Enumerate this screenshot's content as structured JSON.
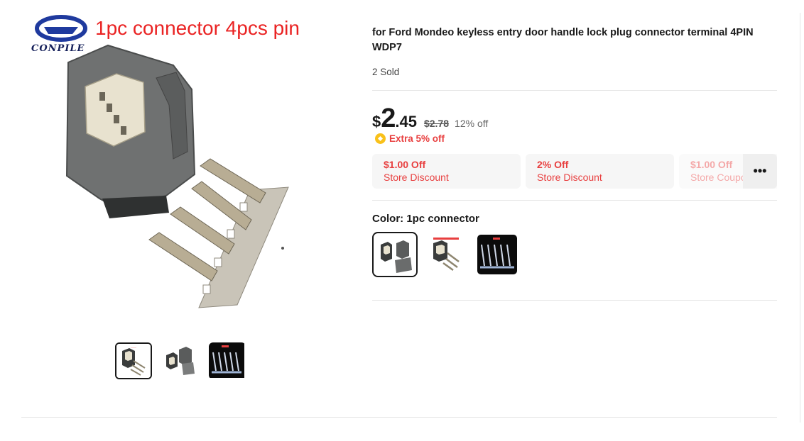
{
  "product": {
    "title": "for Ford Mondeo keyless entry door handle lock plug connector terminal 4PIN WDP7",
    "sold": "2 Sold",
    "image_caption": "1pc connector 4pcs pin",
    "brand": "CONPILE"
  },
  "price": {
    "currency": "$",
    "integer": "2",
    "decimal": ".45",
    "original": "$2.78",
    "discount": "12% off",
    "extra": "Extra 5% off"
  },
  "coupons": [
    {
      "title": "$1.00 Off",
      "subtitle": "Store Discount"
    },
    {
      "title": "2% Off",
      "subtitle": "Store Discount"
    },
    {
      "title": "$1.00 Off",
      "subtitle": "Store Coupon"
    }
  ],
  "more_label": "•••",
  "color": {
    "label": "Color: ",
    "value": "1pc connector"
  },
  "icons": {
    "extra": "coin-icon",
    "more": "more-dots-icon"
  },
  "colors": {
    "accent_red": "#e83f3f",
    "caption_red": "#ea2323",
    "coin_yellow": "#f9c11a"
  }
}
